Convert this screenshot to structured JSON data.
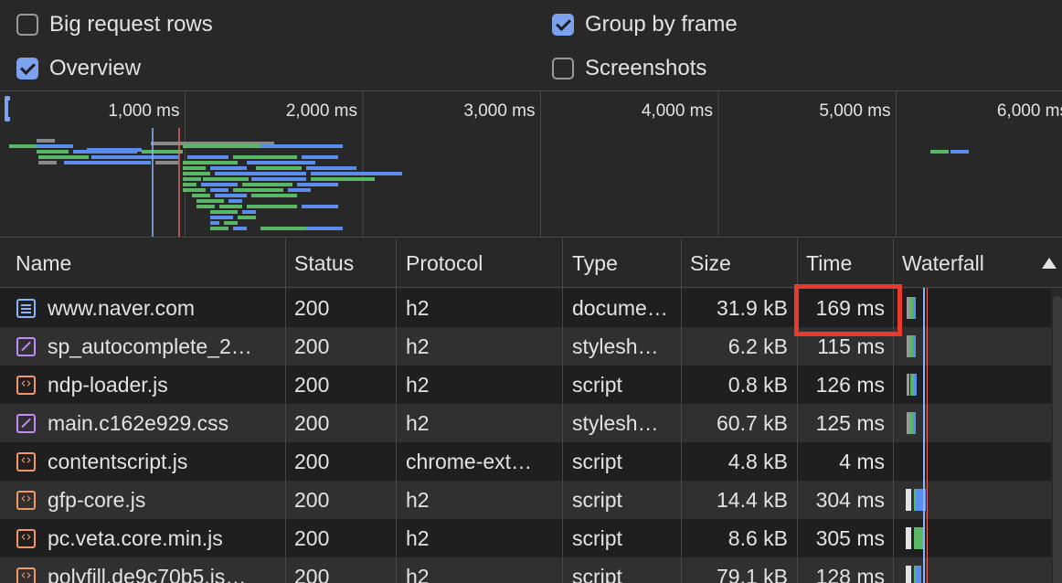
{
  "options": {
    "big_request_rows": {
      "label": "Big request rows",
      "checked": false
    },
    "group_by_frame": {
      "label": "Group by frame",
      "checked": true
    },
    "overview": {
      "label": "Overview",
      "checked": true
    },
    "screenshots": {
      "label": "Screenshots",
      "checked": false
    }
  },
  "overview": {
    "ticks": [
      "1,000 ms",
      "2,000 ms",
      "3,000 ms",
      "4,000 ms",
      "5,000 ms",
      "6,000 ms"
    ],
    "colors": {
      "blue": "#5b8dee",
      "green": "#58b866",
      "gray": "#8a8a8a",
      "dom_line": "#8ab4f8",
      "load_line": "#e46962"
    }
  },
  "table": {
    "columns": [
      "Name",
      "Status",
      "Protocol",
      "Type",
      "Size",
      "Time",
      "Waterfall"
    ],
    "sort": "ascending",
    "rows": [
      {
        "icon": "document-icon",
        "name": "www.naver.com",
        "status": "200",
        "protocol": "h2",
        "type": "docume…",
        "size": "31.9 kB",
        "time": "169 ms"
      },
      {
        "icon": "stylesheet-icon",
        "name": "sp_autocomplete_2…",
        "status": "200",
        "protocol": "h2",
        "type": "stylesh…",
        "size": "6.2 kB",
        "time": "115 ms"
      },
      {
        "icon": "script-icon",
        "name": "ndp-loader.js",
        "status": "200",
        "protocol": "h2",
        "type": "script",
        "size": "0.8 kB",
        "time": "126 ms"
      },
      {
        "icon": "stylesheet-icon",
        "name": "main.c162e929.css",
        "status": "200",
        "protocol": "h2",
        "type": "stylesh…",
        "size": "60.7 kB",
        "time": "125 ms"
      },
      {
        "icon": "script-icon",
        "name": "contentscript.js",
        "status": "200",
        "protocol": "chrome-ext…",
        "type": "script",
        "size": "4.8 kB",
        "time": "4 ms"
      },
      {
        "icon": "script-icon",
        "name": "gfp-core.js",
        "status": "200",
        "protocol": "h2",
        "type": "script",
        "size": "14.4 kB",
        "time": "304 ms"
      },
      {
        "icon": "script-icon",
        "name": "pc.veta.core.min.js",
        "status": "200",
        "protocol": "h2",
        "type": "script",
        "size": "8.6 kB",
        "time": "305 ms"
      },
      {
        "icon": "script-icon",
        "name": "polyfill.de9c70b5.js…",
        "status": "200",
        "protocol": "h2",
        "type": "script",
        "size": "79.1 kB",
        "time": "128 ms"
      }
    ],
    "highlighted_cell": "169 ms"
  }
}
